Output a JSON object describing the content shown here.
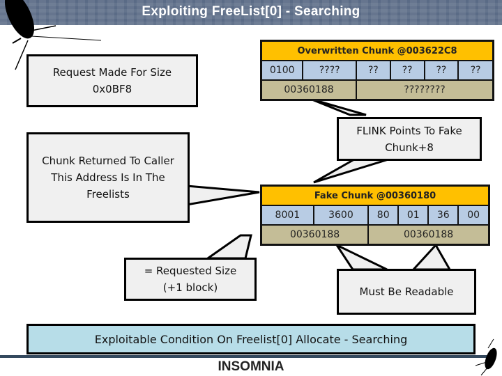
{
  "header": {
    "title": "Exploiting FreeList[0] - Searching"
  },
  "callouts": {
    "request": {
      "line1": "Request Made For Size",
      "line2": "0x0BF8"
    },
    "returned": {
      "line1": "Chunk Returned To Caller",
      "line2": "This Address Is In The",
      "line3": "Freelists"
    },
    "flink": {
      "line1": "FLINK Points To Fake",
      "line2": "Chunk+8"
    },
    "requested_size": {
      "line1": "= Requested Size",
      "line2": "(+1 block)"
    },
    "readable": {
      "text": "Must Be Readable"
    }
  },
  "overwritten_chunk": {
    "title": "Overwritten Chunk @003622C8",
    "row1": [
      "0100",
      "????",
      "??",
      "??",
      "??",
      "??"
    ],
    "row2": [
      "00360188",
      "????????"
    ]
  },
  "fake_chunk": {
    "title": "Fake Chunk @00360180",
    "row1": [
      "8001",
      "3600",
      "80",
      "01",
      "36",
      "00"
    ],
    "row2": [
      "00360188",
      "00360188"
    ]
  },
  "footer": {
    "banner": "Exploitable Condition On Freelist[0] Allocate - Searching",
    "logo": "INSOMNIA"
  },
  "colors": {
    "header": "#5a6b86",
    "chunk_title": "#ffc000",
    "row_blue": "#b8cce4",
    "row_tan": "#c4bd97",
    "banner": "#b7dde8"
  }
}
